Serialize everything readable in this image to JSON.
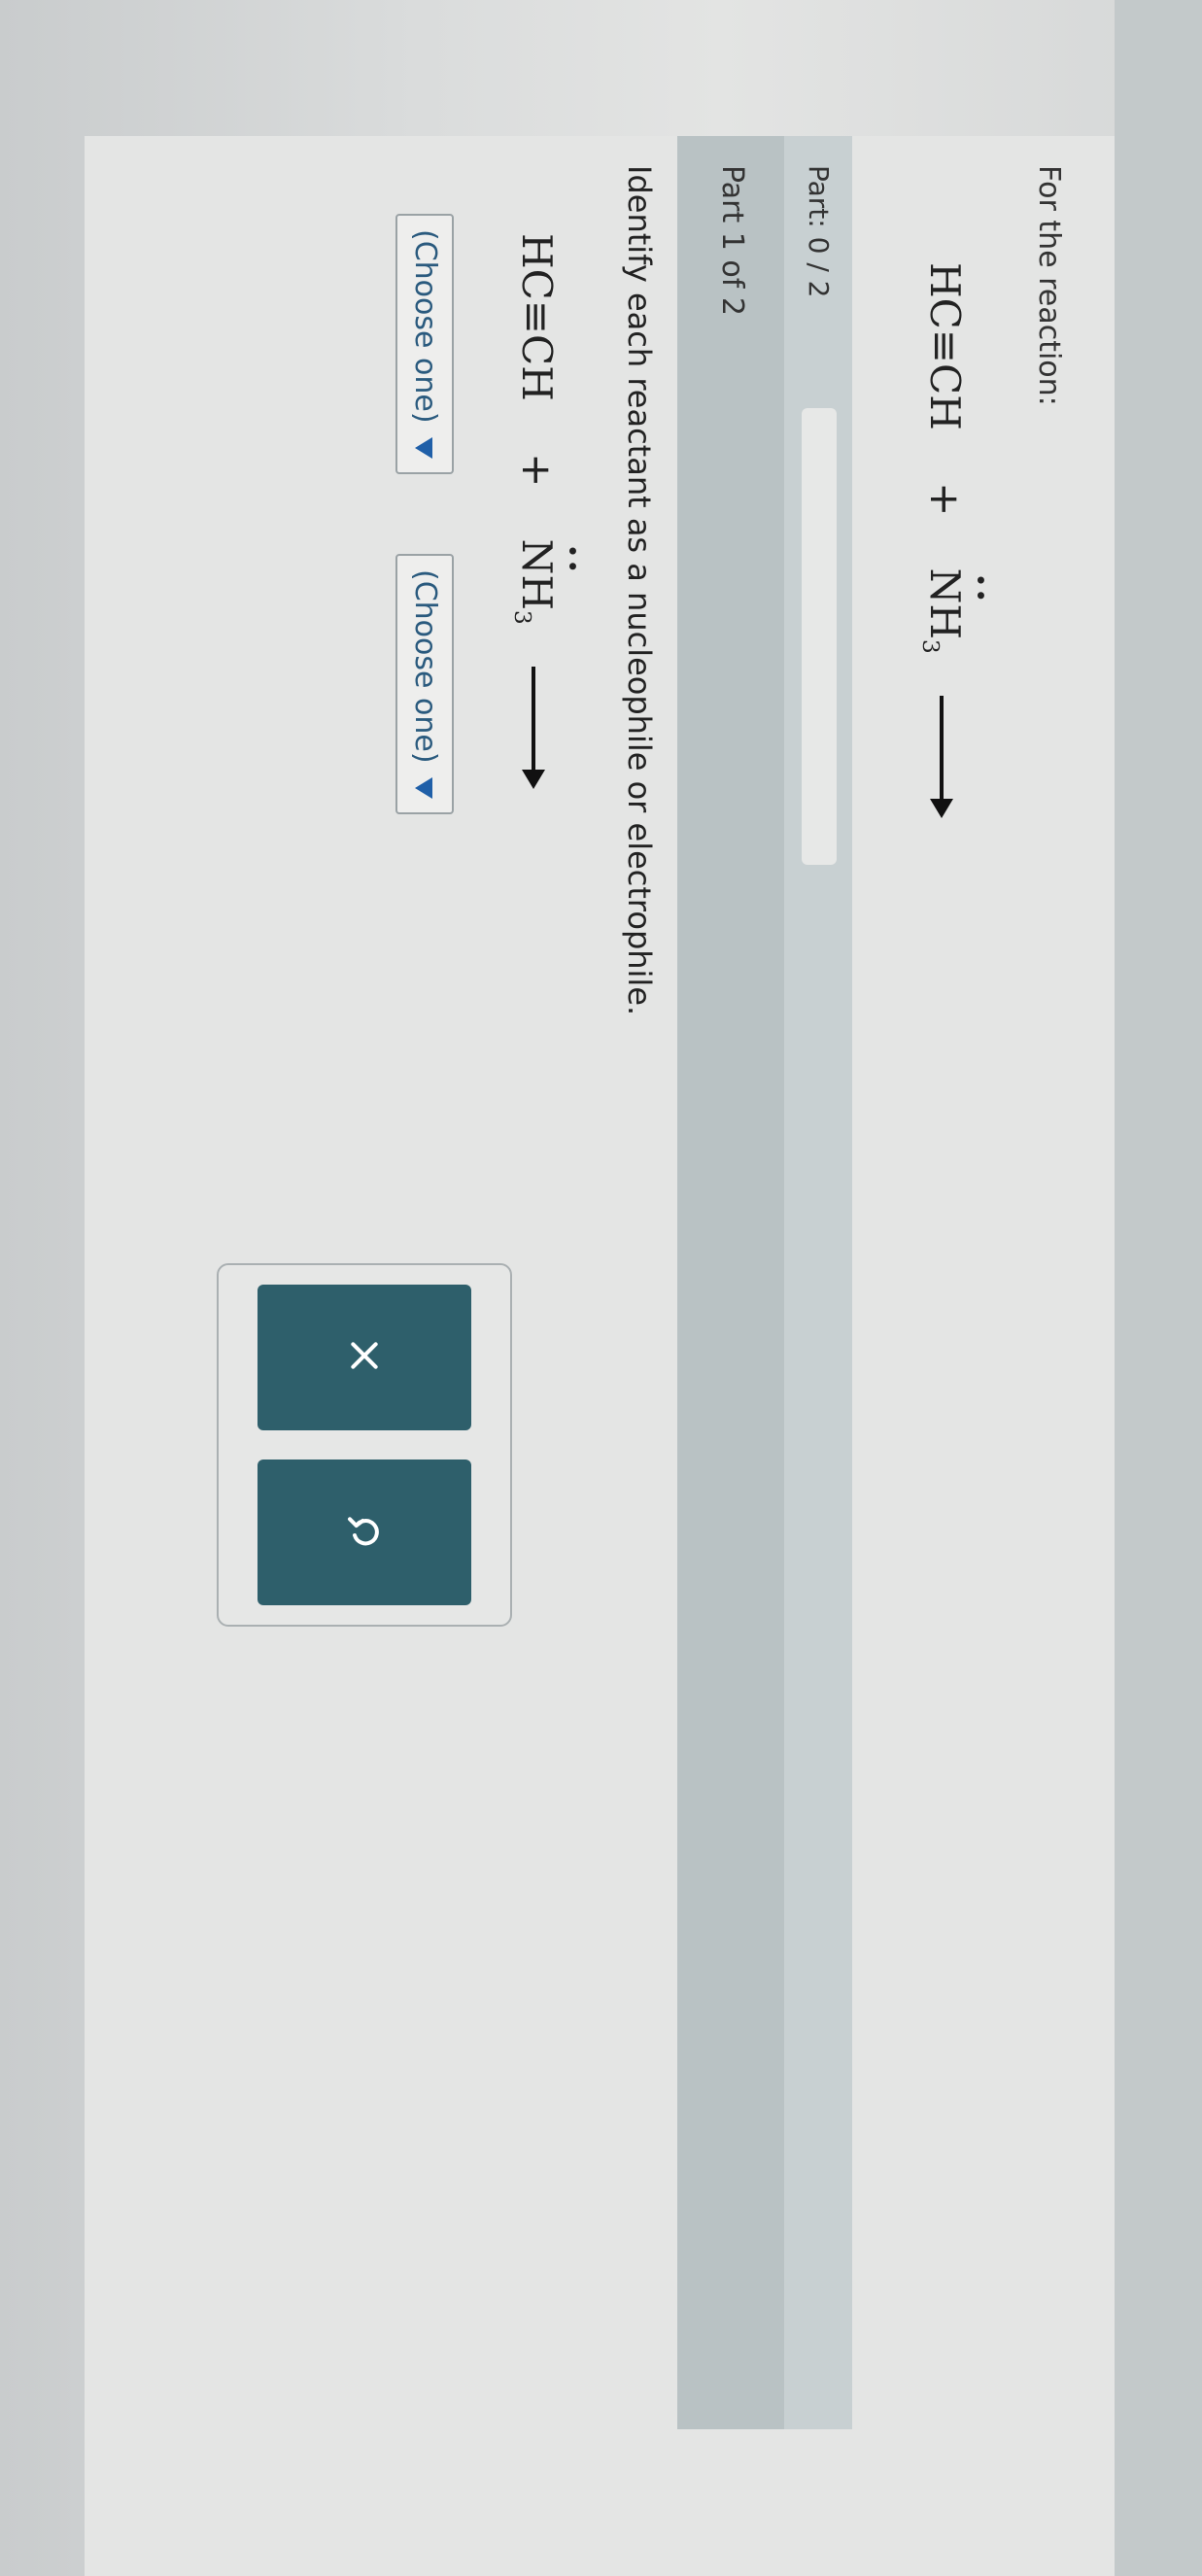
{
  "question": {
    "title": "For the reaction:",
    "equation": {
      "reactant1": "HC≡CH",
      "plus": "+",
      "reactant2_main": "NH",
      "reactant2_sub": "3",
      "lone_pair": "••"
    }
  },
  "progress": {
    "label": "Part: 0 / 2",
    "completed": 0,
    "total": 2
  },
  "part": {
    "header": "Part 1 of 2",
    "instruction": "Identify each reactant as a nucleophile or electrophile.",
    "equation": {
      "reactant1": "HC≡CH",
      "plus": "+",
      "reactant2_main": "NH",
      "reactant2_sub": "3",
      "lone_pair": "••"
    },
    "dropdowns": [
      {
        "selected": "(Choose one)"
      },
      {
        "selected": "(Choose one)"
      }
    ]
  },
  "actions": {
    "clear_icon": "x-icon",
    "undo_icon": "undo-icon"
  },
  "colors": {
    "button_bg": "#2e5f6b",
    "dropdown_text": "#2a5a7e",
    "caret": "#1f5fa8"
  }
}
